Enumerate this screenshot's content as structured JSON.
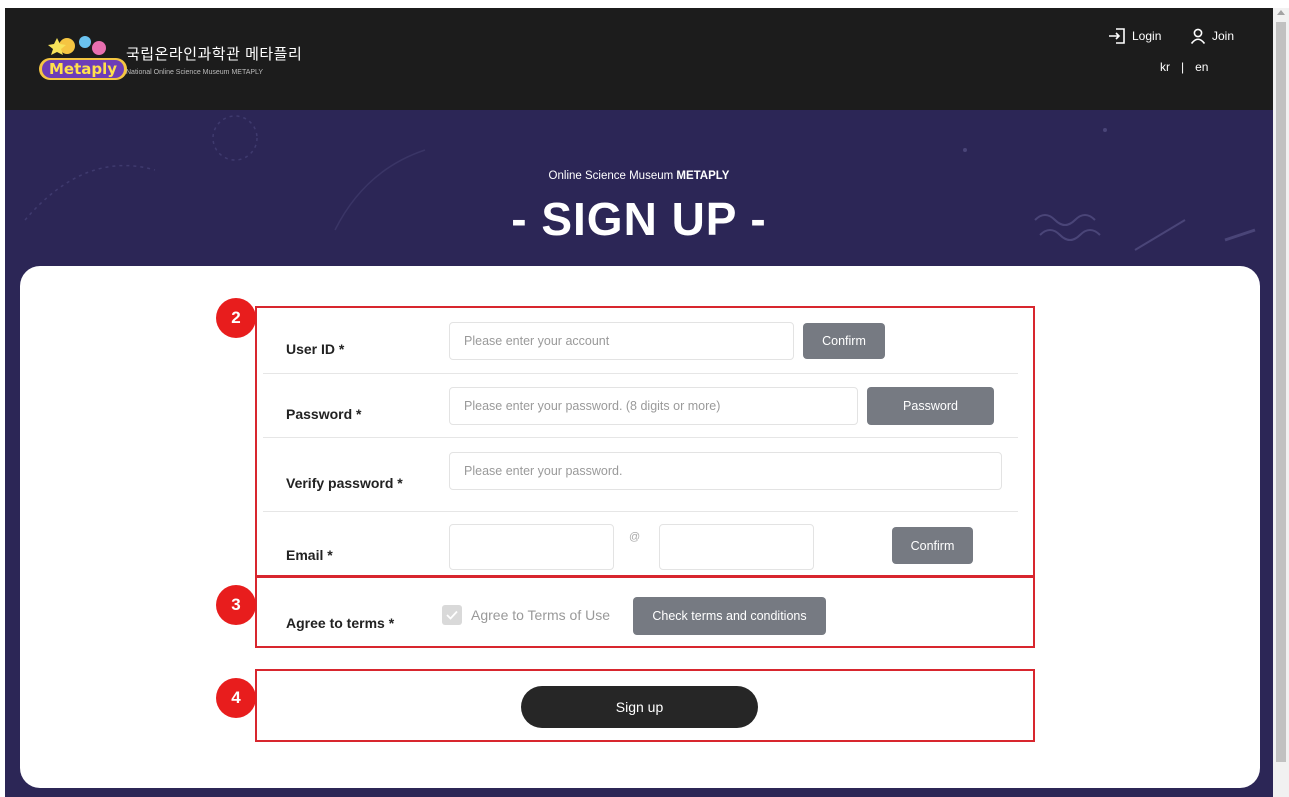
{
  "header": {
    "brand_kr": "국립온라인과학관 메타플리",
    "brand_en": "National Online Science Museum METAPLY",
    "logo_text": "Metaply",
    "login_label": "Login",
    "join_label": "Join",
    "lang_kr": "kr",
    "lang_sep": "|",
    "lang_en": "en"
  },
  "hero": {
    "subtitle_prefix": "Online Science Museum ",
    "subtitle_bold": "METAPLY",
    "title": "- SIGN UP -"
  },
  "form": {
    "user_id": {
      "label": "User ID *",
      "placeholder": "Please enter your account",
      "button": "Confirm"
    },
    "password": {
      "label": "Password *",
      "placeholder": "Please enter your password. (8 digits or more)",
      "button": "Password"
    },
    "verify": {
      "label": "Verify password *",
      "placeholder": "Please enter your password."
    },
    "email": {
      "label": "Email *",
      "at": "@",
      "button": "Confirm"
    },
    "terms": {
      "label": "Agree to terms *",
      "checkbox_label": "Agree to Terms of Use",
      "button": "Check terms and conditions"
    },
    "submit": "Sign up"
  },
  "annotations": {
    "badge_2": "2",
    "badge_3": "3",
    "badge_4": "4"
  },
  "colors": {
    "header_bg": "#1c1c1c",
    "hero_bg": "#2c2656",
    "highlight": "#d8262e",
    "badge": "#e81d1d",
    "button_gray": "#767a82",
    "submit_bg": "#262626"
  }
}
